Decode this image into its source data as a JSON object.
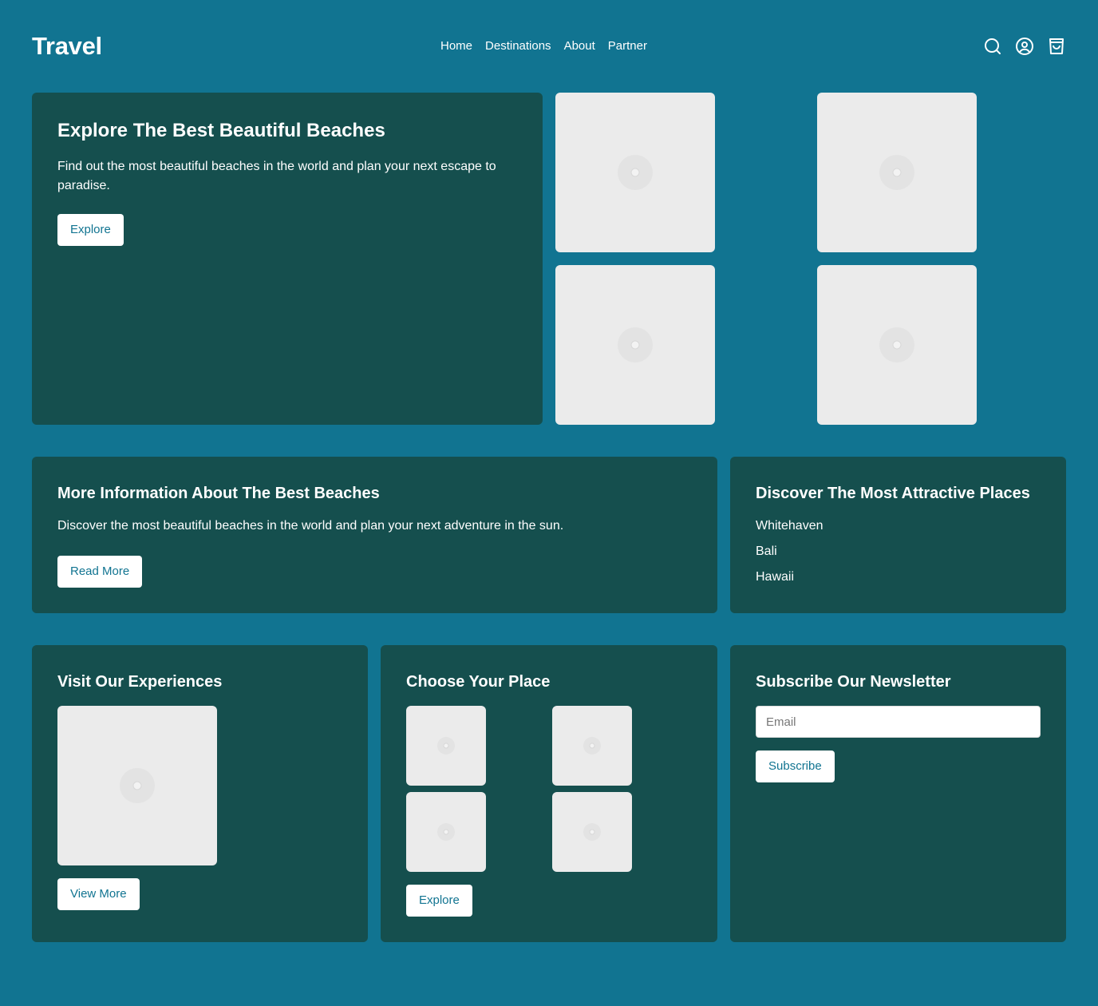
{
  "header": {
    "logo": "Travel",
    "nav": [
      "Home",
      "Destinations",
      "About",
      "Partner"
    ],
    "icons": [
      "search-icon",
      "user-icon",
      "cart-icon"
    ]
  },
  "hero": {
    "title": "Explore The Best Beautiful Beaches",
    "description": "Find out the most beautiful beaches in the world and plan your next escape to paradise.",
    "button": "Explore"
  },
  "info": {
    "title": "More Information About The Best Beaches",
    "description": "Discover the most beautiful beaches in the world and plan your next adventure in the sun.",
    "button": "Read More"
  },
  "places": {
    "title": "Discover The Most Attractive Places",
    "items": [
      "Whitehaven",
      "Bali",
      "Hawaii"
    ]
  },
  "experiences": {
    "title": "Visit Our Experiences",
    "button": "View More"
  },
  "choose": {
    "title": "Choose Your Place",
    "button": "Explore"
  },
  "newsletter": {
    "title": "Subscribe Our Newsletter",
    "email_placeholder": "Email",
    "button": "Subscribe"
  },
  "colors": {
    "background": "#117491",
    "card": "#154f4e",
    "placeholder": "#ebebeb",
    "button_text": "#117491"
  }
}
